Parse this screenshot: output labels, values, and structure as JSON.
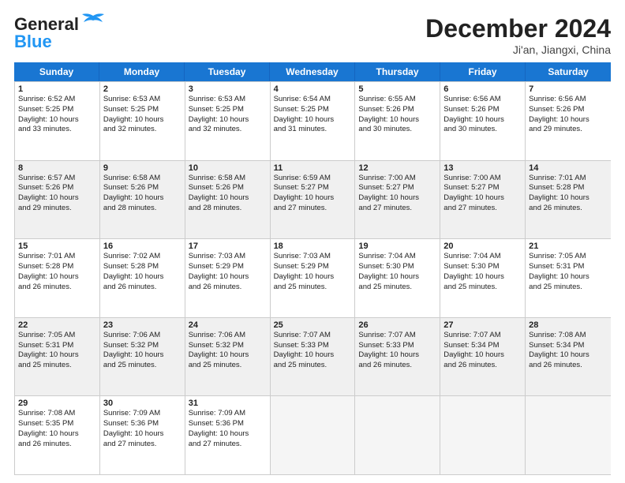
{
  "logo": {
    "line1": "General",
    "line2": "Blue"
  },
  "title": "December 2024",
  "location": "Ji'an, Jiangxi, China",
  "headers": [
    "Sunday",
    "Monday",
    "Tuesday",
    "Wednesday",
    "Thursday",
    "Friday",
    "Saturday"
  ],
  "rows": [
    [
      {
        "day": "1",
        "info": "Sunrise: 6:52 AM\nSunset: 5:25 PM\nDaylight: 10 hours\nand 33 minutes."
      },
      {
        "day": "2",
        "info": "Sunrise: 6:53 AM\nSunset: 5:25 PM\nDaylight: 10 hours\nand 32 minutes."
      },
      {
        "day": "3",
        "info": "Sunrise: 6:53 AM\nSunset: 5:25 PM\nDaylight: 10 hours\nand 32 minutes."
      },
      {
        "day": "4",
        "info": "Sunrise: 6:54 AM\nSunset: 5:25 PM\nDaylight: 10 hours\nand 31 minutes."
      },
      {
        "day": "5",
        "info": "Sunrise: 6:55 AM\nSunset: 5:26 PM\nDaylight: 10 hours\nand 30 minutes."
      },
      {
        "day": "6",
        "info": "Sunrise: 6:56 AM\nSunset: 5:26 PM\nDaylight: 10 hours\nand 30 minutes."
      },
      {
        "day": "7",
        "info": "Sunrise: 6:56 AM\nSunset: 5:26 PM\nDaylight: 10 hours\nand 29 minutes."
      }
    ],
    [
      {
        "day": "8",
        "info": "Sunrise: 6:57 AM\nSunset: 5:26 PM\nDaylight: 10 hours\nand 29 minutes."
      },
      {
        "day": "9",
        "info": "Sunrise: 6:58 AM\nSunset: 5:26 PM\nDaylight: 10 hours\nand 28 minutes."
      },
      {
        "day": "10",
        "info": "Sunrise: 6:58 AM\nSunset: 5:26 PM\nDaylight: 10 hours\nand 28 minutes."
      },
      {
        "day": "11",
        "info": "Sunrise: 6:59 AM\nSunset: 5:27 PM\nDaylight: 10 hours\nand 27 minutes."
      },
      {
        "day": "12",
        "info": "Sunrise: 7:00 AM\nSunset: 5:27 PM\nDaylight: 10 hours\nand 27 minutes."
      },
      {
        "day": "13",
        "info": "Sunrise: 7:00 AM\nSunset: 5:27 PM\nDaylight: 10 hours\nand 27 minutes."
      },
      {
        "day": "14",
        "info": "Sunrise: 7:01 AM\nSunset: 5:28 PM\nDaylight: 10 hours\nand 26 minutes."
      }
    ],
    [
      {
        "day": "15",
        "info": "Sunrise: 7:01 AM\nSunset: 5:28 PM\nDaylight: 10 hours\nand 26 minutes."
      },
      {
        "day": "16",
        "info": "Sunrise: 7:02 AM\nSunset: 5:28 PM\nDaylight: 10 hours\nand 26 minutes."
      },
      {
        "day": "17",
        "info": "Sunrise: 7:03 AM\nSunset: 5:29 PM\nDaylight: 10 hours\nand 26 minutes."
      },
      {
        "day": "18",
        "info": "Sunrise: 7:03 AM\nSunset: 5:29 PM\nDaylight: 10 hours\nand 25 minutes."
      },
      {
        "day": "19",
        "info": "Sunrise: 7:04 AM\nSunset: 5:30 PM\nDaylight: 10 hours\nand 25 minutes."
      },
      {
        "day": "20",
        "info": "Sunrise: 7:04 AM\nSunset: 5:30 PM\nDaylight: 10 hours\nand 25 minutes."
      },
      {
        "day": "21",
        "info": "Sunrise: 7:05 AM\nSunset: 5:31 PM\nDaylight: 10 hours\nand 25 minutes."
      }
    ],
    [
      {
        "day": "22",
        "info": "Sunrise: 7:05 AM\nSunset: 5:31 PM\nDaylight: 10 hours\nand 25 minutes."
      },
      {
        "day": "23",
        "info": "Sunrise: 7:06 AM\nSunset: 5:32 PM\nDaylight: 10 hours\nand 25 minutes."
      },
      {
        "day": "24",
        "info": "Sunrise: 7:06 AM\nSunset: 5:32 PM\nDaylight: 10 hours\nand 25 minutes."
      },
      {
        "day": "25",
        "info": "Sunrise: 7:07 AM\nSunset: 5:33 PM\nDaylight: 10 hours\nand 25 minutes."
      },
      {
        "day": "26",
        "info": "Sunrise: 7:07 AM\nSunset: 5:33 PM\nDaylight: 10 hours\nand 26 minutes."
      },
      {
        "day": "27",
        "info": "Sunrise: 7:07 AM\nSunset: 5:34 PM\nDaylight: 10 hours\nand 26 minutes."
      },
      {
        "day": "28",
        "info": "Sunrise: 7:08 AM\nSunset: 5:34 PM\nDaylight: 10 hours\nand 26 minutes."
      }
    ],
    [
      {
        "day": "29",
        "info": "Sunrise: 7:08 AM\nSunset: 5:35 PM\nDaylight: 10 hours\nand 26 minutes."
      },
      {
        "day": "30",
        "info": "Sunrise: 7:09 AM\nSunset: 5:36 PM\nDaylight: 10 hours\nand 27 minutes."
      },
      {
        "day": "31",
        "info": "Sunrise: 7:09 AM\nSunset: 5:36 PM\nDaylight: 10 hours\nand 27 minutes."
      },
      {
        "day": "",
        "info": ""
      },
      {
        "day": "",
        "info": ""
      },
      {
        "day": "",
        "info": ""
      },
      {
        "day": "",
        "info": ""
      }
    ]
  ]
}
